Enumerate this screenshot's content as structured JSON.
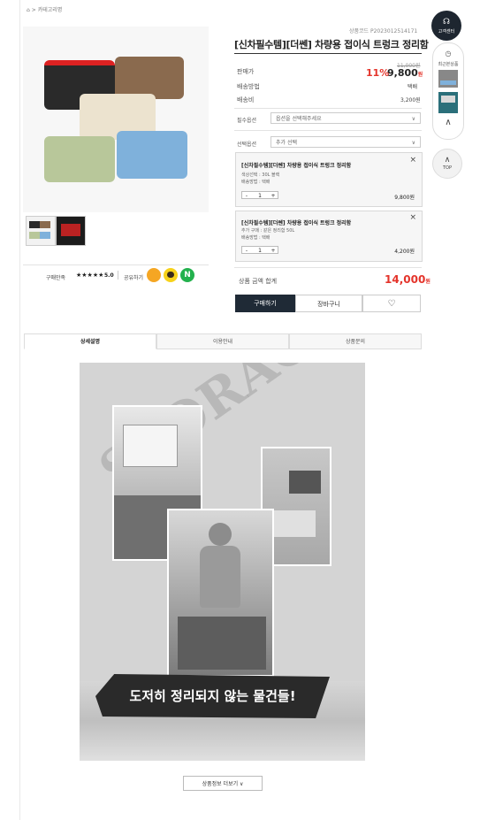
{
  "breadcrumb": {
    "home": "⌂",
    "sep": ">",
    "current": "카테고리명"
  },
  "product": {
    "code": "상품코드 P2023012514171",
    "title": "[신차필수템][더쎈] 차량용 접이식 트렁크 정리함",
    "price_label": "판매가",
    "original_price": "11,000원",
    "discount": "11%",
    "sale_price": "9,800",
    "sale_unit": "원",
    "shipping_method_label": "배송방법",
    "shipping_method": "택배",
    "shipping_fee_label": "배송비",
    "shipping_fee": "3,200원",
    "required_option_label": "필수옵션",
    "required_option_placeholder": "옵션을 선택해주세요",
    "extra_option_label": "선택옵션",
    "extra_option_placeholder": "추가 선택",
    "option1": {
      "name": "[신차필수템][더쎈] 차량용 접이식 트렁크 정리함",
      "line1": "색상선택 : 30L 블랙",
      "line2": "배송방법 : 택배",
      "qty": "1",
      "price": "9,800원"
    },
    "option2": {
      "name": "[신차필수템][더쎈] 차량용 접이식 트렁크 정리함",
      "line1": "추가 구매 : 같은 정리함 50L",
      "line2": "배송방법 : 택배",
      "qty": "1",
      "price": "4,200원"
    },
    "total_label": "상품 금액 합계",
    "total_price": "14,000",
    "total_unit": "원",
    "buy_label": "구매하기",
    "cart_label": "장바구니",
    "wish_icon": "♡",
    "rating_label": "구매만족",
    "stars": "★★★★★",
    "rating_value": "5.0",
    "share_label": "공유하기"
  },
  "tabs": [
    "상세설명",
    "이용안내",
    "상품문의"
  ],
  "detail": {
    "watermark": "STORAGE BOX",
    "caption": "도저히 정리되지 않는 물건들!",
    "more_label": "상품정보 더보기 ∨"
  },
  "side": {
    "cs_label": "고객센터",
    "recent_label": "최근본상품",
    "top_label": "TOP"
  },
  "colors": {
    "accent_red": "#e4342b",
    "dark_btn": "#1f2a36",
    "share_kakao": "#f5a623",
    "share_yellow": "#f7d21a",
    "share_naver": "#23b14d"
  }
}
